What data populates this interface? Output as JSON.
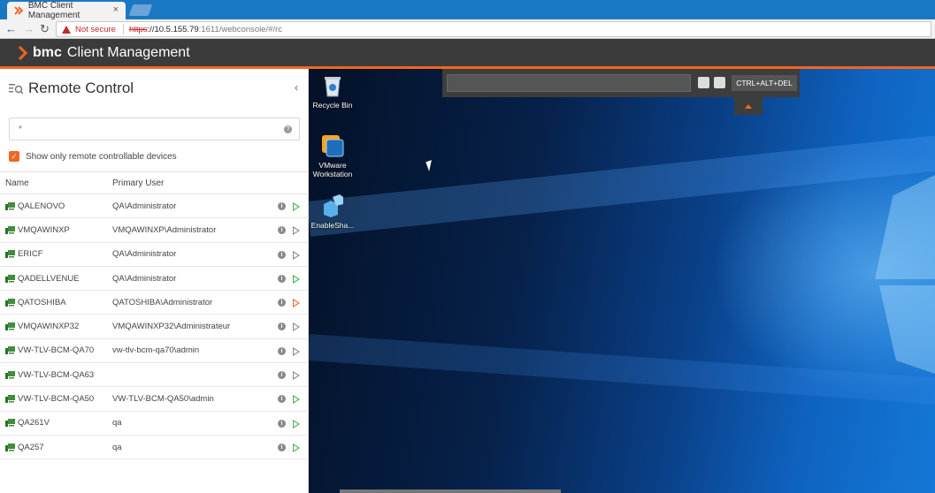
{
  "browser": {
    "tab_title": "BMC Client Management",
    "tab_close": "×",
    "security_label": "Not secure",
    "url_scheme": "https",
    "url_host": "://10.5.155.79",
    "url_path": ":1611/webconsole/#/rc",
    "back": "←",
    "forward": "→",
    "reload": "↻"
  },
  "app": {
    "brand": "bmc",
    "title": "Client Management"
  },
  "panel": {
    "title": "Remote Control",
    "collapse": "‹",
    "search_placeholder": "*",
    "search_help": "?",
    "checkbox_label": "Show only remote controllable devices",
    "checkbox_checked": true,
    "columns": {
      "name": "Name",
      "user": "Primary User"
    },
    "rows": [
      {
        "name": "QALENOVO",
        "user": "QA\\Administrator",
        "play_color": "#4caf50"
      },
      {
        "name": "VMQAWINXP",
        "user": "VMQAWINXP\\Administrator",
        "play_color": "#8a8a8a"
      },
      {
        "name": "ERICF",
        "user": "QA\\Administrator",
        "play_color": "#8a8a8a"
      },
      {
        "name": "QADELLVENUE",
        "user": "QA\\Administrator",
        "play_color": "#4caf50"
      },
      {
        "name": "QATOSHIBA",
        "user": "QATOSHIBA\\Administrator",
        "play_color": "#f26522"
      },
      {
        "name": "VMQAWINXP32",
        "user": "VMQAWINXP32\\Administrateur",
        "play_color": "#8a8a8a"
      },
      {
        "name": "VW-TLV-BCM-QA70",
        "user": "vw-tlv-bcm-qa70\\admin",
        "play_color": "#8a8a8a"
      },
      {
        "name": "VW-TLV-BCM-QA63",
        "user": "",
        "play_color": "#8a8a8a"
      },
      {
        "name": "VW-TLV-BCM-QA50",
        "user": "VW-TLV-BCM-QA50\\admin",
        "play_color": "#4caf50"
      },
      {
        "name": "QA261V",
        "user": "qa",
        "play_color": "#4caf50"
      },
      {
        "name": "QA257",
        "user": "qa",
        "play_color": "#4caf50"
      }
    ]
  },
  "remote": {
    "cad_label": "CTRL+ALT+DEL",
    "desktop_icons": [
      {
        "label": "Recycle Bin",
        "icon": "recycle-bin-icon"
      },
      {
        "label": "VMware Workstation",
        "icon": "vmware-icon"
      },
      {
        "label": "EnableSha...",
        "icon": "enable-share-icon"
      }
    ]
  },
  "colors": {
    "accent": "#f26522",
    "header_bg": "#3b3b3b",
    "browser_blue": "#1a78c2"
  }
}
